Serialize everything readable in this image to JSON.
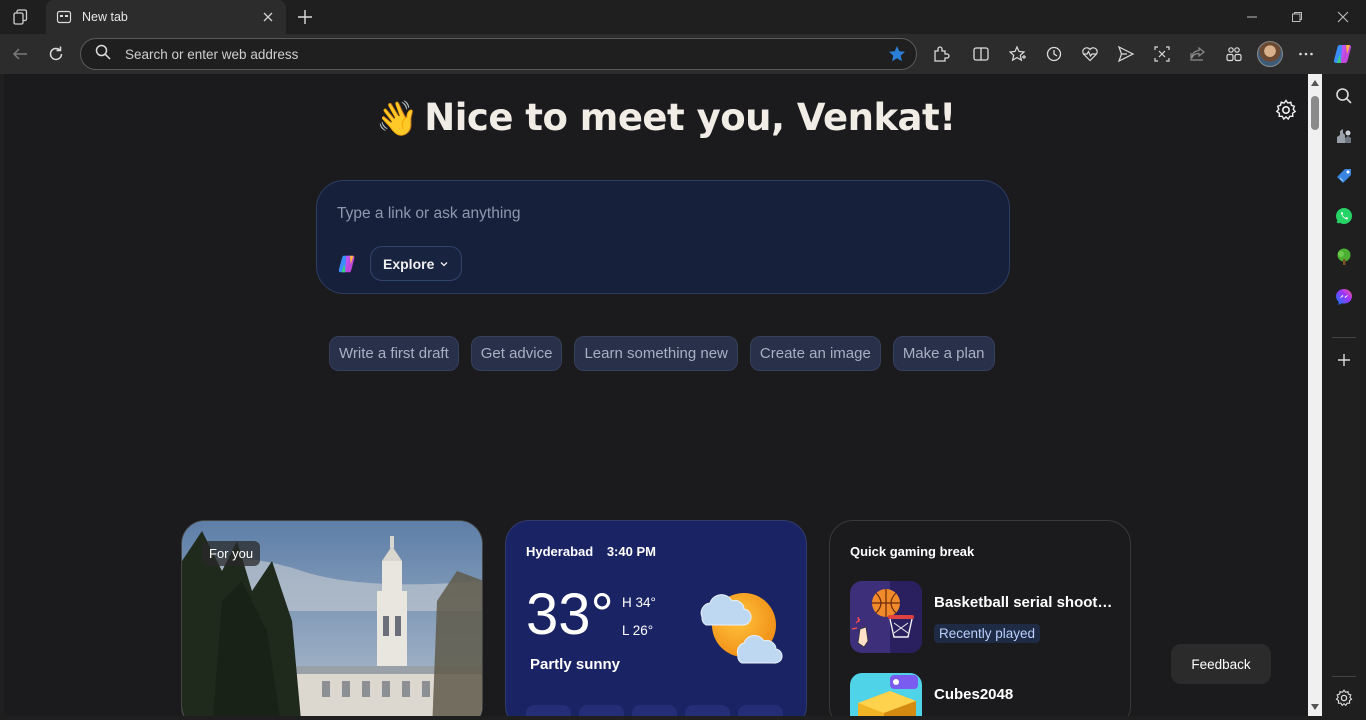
{
  "tab": {
    "title": "New tab"
  },
  "address_bar": {
    "placeholder": "Search or enter web address"
  },
  "greeting": {
    "emoji": "👋",
    "text": "Nice to meet you, Venkat!"
  },
  "ask": {
    "placeholder": "Type a link or ask anything",
    "explore_label": "Explore"
  },
  "suggestions": [
    "Write a first draft",
    "Get advice",
    "Learn something new",
    "Create an image",
    "Make a plan"
  ],
  "foryou": {
    "badge": "For you"
  },
  "weather": {
    "city": "Hyderabad",
    "time": "3:40 PM",
    "temp": "33°",
    "high": "H 34°",
    "low": "L 26°",
    "condition": "Partly sunny"
  },
  "gaming": {
    "title": "Quick gaming break",
    "games": [
      {
        "name": "Basketball serial shoot…",
        "tag": "Recently played"
      },
      {
        "name": "Cubes2048"
      }
    ]
  },
  "feedback": {
    "label": "Feedback"
  },
  "colors": {
    "accent_star": "#2b7fd6",
    "weather_card": "#1a2464",
    "ask_box": "#16203a"
  }
}
